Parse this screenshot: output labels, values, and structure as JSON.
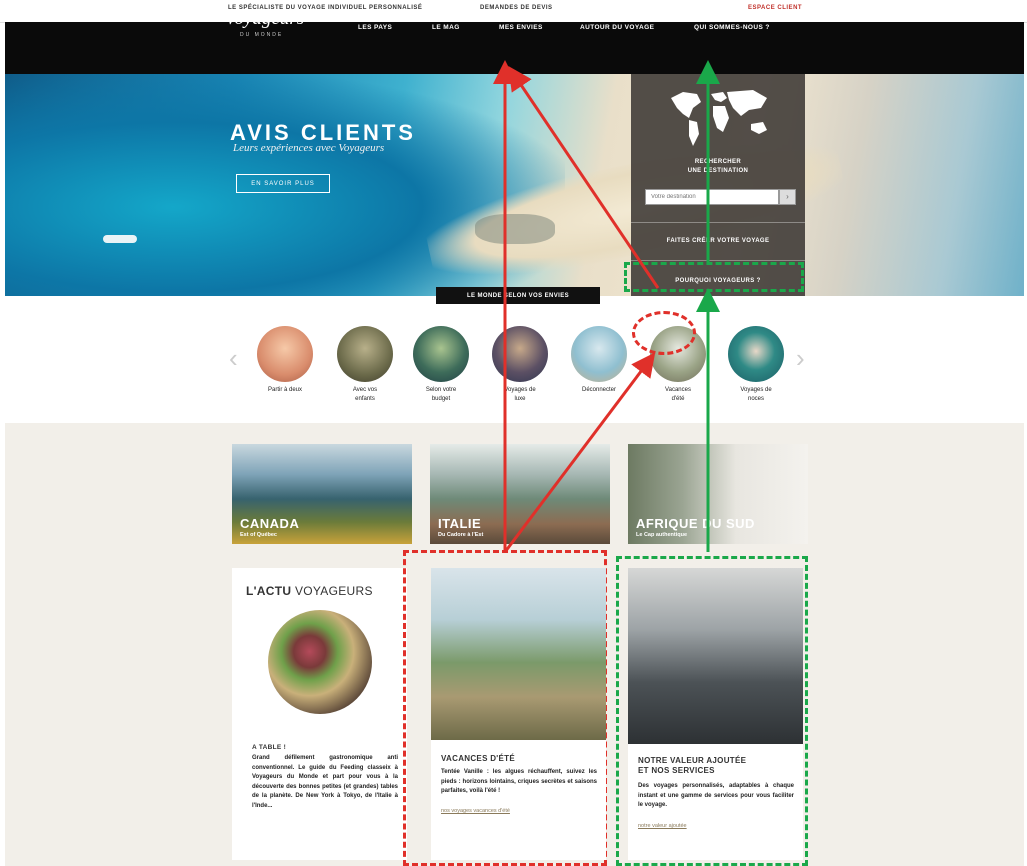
{
  "utilbar": {
    "left_text": "LE SPÉCIALISTE DU VOYAGE INDIVIDUEL PERSONNALISÉ",
    "center_text": "DEMANDES DE DEVIS",
    "right_text": "ESPACE CLIENT"
  },
  "nav": {
    "logo": "Voyageurs",
    "logo_sub": "DU MONDE",
    "items": [
      "LES PAYS",
      "LE MAG",
      "MES ENVIES",
      "AUTOUR DU VOYAGE",
      "QUI SOMMES-NOUS ?"
    ]
  },
  "hero": {
    "title": "AVIS CLIENTS",
    "subtitle": "Leurs expériences avec Voyageurs",
    "button": "EN SAVOIR PLUS"
  },
  "panel": {
    "search_label_1": "RECHERCHER",
    "search_label_2": "UNE DESTINATION",
    "input_placeholder": "Votre destination",
    "search_icon": "search-icon",
    "create_trip": "FAITES CRÉER VOTRE VOYAGE",
    "why": "POURQUOI VOYAGEURS ?"
  },
  "categories": {
    "title": "LE MONDE SELON VOS ENVIES",
    "items": [
      {
        "line1": "Partir à deux",
        "line2": ""
      },
      {
        "line1": "Avec vos",
        "line2": "enfants"
      },
      {
        "line1": "Selon votre",
        "line2": "budget"
      },
      {
        "line1": "Voyages de",
        "line2": "luxe"
      },
      {
        "line1": "Déconnecter",
        "line2": ""
      },
      {
        "line1": "Vacances",
        "line2": "d'été"
      },
      {
        "line1": "Voyages de",
        "line2": "noces"
      }
    ]
  },
  "destinations": [
    {
      "name": "CANADA",
      "sub": "Est of Québec"
    },
    {
      "name": "ITALIE",
      "sub": "Du Cadore à l'Est"
    },
    {
      "name": "AFRIQUE DU SUD",
      "sub": "Le Cap authentique"
    }
  ],
  "cards": {
    "actu": {
      "title_bold": "L'ACTU",
      "title_light": " VOYAGEURS",
      "heading": "A TABLE !",
      "text": "Grand défilement gastronomique anti conventionnel. Le guide du Feeding classeix à Voyageurs du Monde et part pour vous à la découverte des bonnes petites (et grandes) tables de la planète. De New York à Tokyo, de l'Italie à l'Inde..."
    },
    "vacances": {
      "title": "VACANCES D'ÉTÉ",
      "text": "Tentée Vanille : les algues réchauffent, suivez les pieds : horizons lointains, criques secrètes et saisons parfaites, voilà l'été !",
      "link": "nos voyages vacances d'été"
    },
    "valeur": {
      "title_line1": "NOTRE VALEUR AJOUTÉE",
      "title_line2": "ET NOS SERVICES",
      "text": "Des voyages personnalisés, adaptables à chaque instant et une gamme de services pour vous faciliter le voyage.",
      "link": "notre valeur ajoutée"
    }
  },
  "colors": {
    "annotation_red": "#e0302a",
    "annotation_green": "#1aa84a"
  }
}
